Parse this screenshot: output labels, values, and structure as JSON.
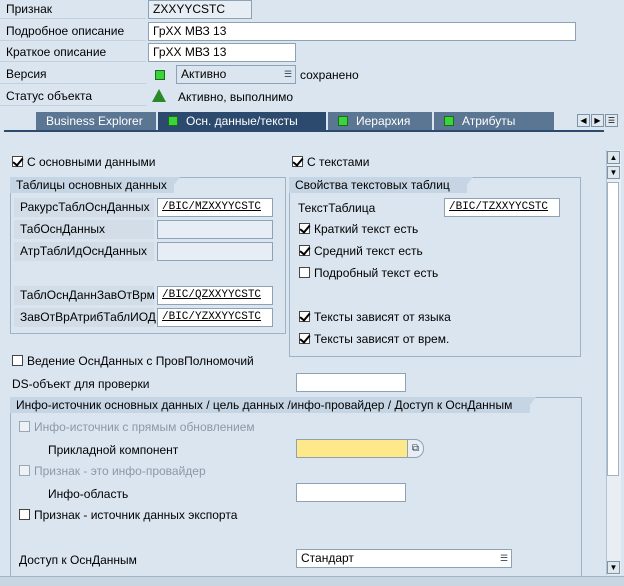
{
  "header": {
    "rows": [
      {
        "label": "Признак",
        "value": "ZXXYYCSTC"
      },
      {
        "label": "Подробное описание",
        "value": "ГрХХ МВЗ 13"
      },
      {
        "label": "Краткое описание",
        "value": "ГрХХ МВЗ 13"
      },
      {
        "label": "Версия",
        "value": "Активно",
        "extra": "сохранено"
      },
      {
        "label": "Статус объекта",
        "value": "Активно, выполнимо"
      }
    ]
  },
  "tabs": [
    {
      "label": "Business Explorer",
      "active": false,
      "icon": ""
    },
    {
      "label": "Осн. данные/тексты",
      "active": true,
      "icon": "green-status-icon"
    },
    {
      "label": "Иерархия",
      "active": false,
      "icon": "green-status-icon"
    },
    {
      "label": "Атрибуты",
      "active": false,
      "icon": "green-status-icon"
    }
  ],
  "tab_nav": [
    "◀",
    "▶",
    "☰"
  ],
  "master": {
    "checkbox_label": "С основными данными",
    "checked": true,
    "group_title": "Таблицы основных данных",
    "rows": [
      {
        "label": "РакурсТаблОснДанных",
        "value": "/BIC/MZXXYYCSTC"
      },
      {
        "label": "ТабОснДанных",
        "value": ""
      },
      {
        "label": "АтрТаблИдОснДанных",
        "value": ""
      },
      {
        "label": "ТаблОснДаннЗавОтВрм",
        "value": "/BIC/QZXXYYCSTC"
      },
      {
        "label": "ЗавОтВрАтрибТаблИОД",
        "value": "/BIC/YZXXYYCSTC"
      }
    ]
  },
  "texts": {
    "checkbox_label": "С текстами",
    "checked": true,
    "group_title": "Свойства текстовых таблиц",
    "table_label": "ТекстТаблица",
    "table_value": "/BIC/TZXXYYCSTC",
    "options": [
      {
        "label": "Краткий текст есть",
        "checked": true
      },
      {
        "label": "Средний текст есть",
        "checked": true
      },
      {
        "label": "Подробный текст есть",
        "checked": false
      },
      {
        "label": "Тексты зависят от языка",
        "checked": true
      },
      {
        "label": "Тексты зависят от врем.",
        "checked": true
      }
    ]
  },
  "authority": {
    "label": "Ведение ОснДанных с ПровПолномочий",
    "checked": false
  },
  "ds_object": {
    "label": "DS-объект для проверки",
    "value": ""
  },
  "infosource": {
    "group_title": "Инфо-источник основных данных / цель данных /инфо-провайдер / Доступ к ОснДанным",
    "direct_update": {
      "label": "Инфо-источник с прямым обновлением",
      "checked": false,
      "disabled": true
    },
    "app_component": {
      "label": "Прикладной компонент",
      "value": ""
    },
    "is_infoprovider": {
      "label": "Признак - это инфо-провайдер",
      "checked": false,
      "disabled": true
    },
    "info_area": {
      "label": "Инфо-область",
      "value": ""
    },
    "export_source": {
      "label": "Признак - источник данных экспорта",
      "checked": false
    },
    "access": {
      "label": "Доступ к ОснДанным",
      "value": "Стандарт"
    }
  },
  "scroll": {
    "up": "▲",
    "down": "▼"
  },
  "colors": {
    "accent": "#2c4a6e",
    "tab": "#5a7693",
    "status_green": "#3bd23b",
    "required_field": "#fde88a"
  }
}
